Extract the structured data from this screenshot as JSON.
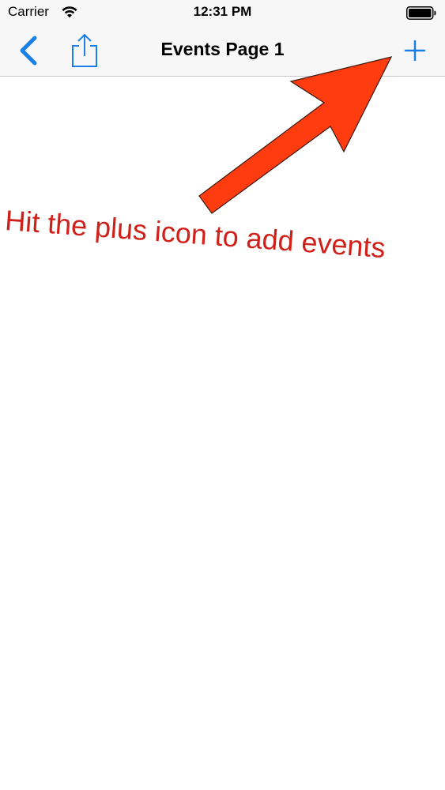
{
  "status_bar": {
    "carrier": "Carrier",
    "time": "12:31 PM",
    "wifi_icon": "wifi-icon",
    "battery_icon": "battery-icon"
  },
  "nav_bar": {
    "title": "Events Page 1",
    "back_icon": "chevron-left-icon",
    "share_icon": "share-icon",
    "add_icon": "plus-icon",
    "accent_color": "#1a7fe6"
  },
  "annotation": {
    "text": "Hit the plus icon to add events",
    "text_color": "#d0201a",
    "arrow_color": "#ff3b10"
  }
}
